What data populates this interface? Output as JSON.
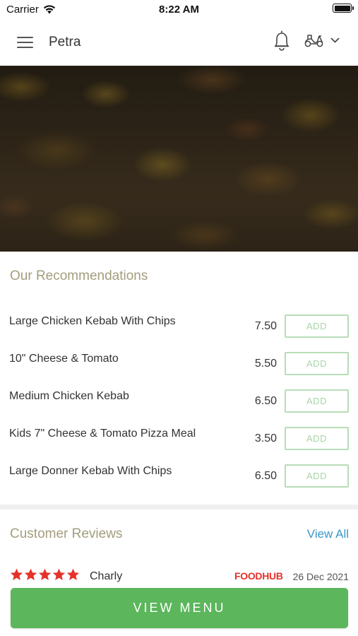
{
  "status_bar": {
    "carrier": "Carrier",
    "time": "8:22 AM"
  },
  "header": {
    "restaurant_name": "Petra",
    "icons": [
      "menu-icon",
      "bell-icon",
      "scooter-icon",
      "chevron-down-icon"
    ]
  },
  "recommendations": {
    "title": "Our Recommendations",
    "add_label": "ADD",
    "items": [
      {
        "name": "Large Chicken Kebab With Chips",
        "price": "7.50"
      },
      {
        "name": "10\" Cheese & Tomato",
        "price": "5.50"
      },
      {
        "name": "Medium Chicken Kebab",
        "price": "6.50"
      },
      {
        "name": "Kids 7\" Cheese & Tomato Pizza Meal",
        "price": "3.50"
      },
      {
        "name": "Large Donner Kebab With Chips",
        "price": "6.50"
      }
    ]
  },
  "reviews": {
    "title": "Customer Reviews",
    "view_all": "View All",
    "items": [
      {
        "reviewer": "Charly",
        "rating": 5,
        "source": "FOODHUB",
        "date": "26 Dec 2021"
      }
    ]
  },
  "view_menu": "VIEW MENU",
  "colors": {
    "accent_green": "#5cb65c",
    "section_title": "#a39d7c",
    "link_blue": "#3a97c7",
    "star_red": "#e4322b"
  }
}
